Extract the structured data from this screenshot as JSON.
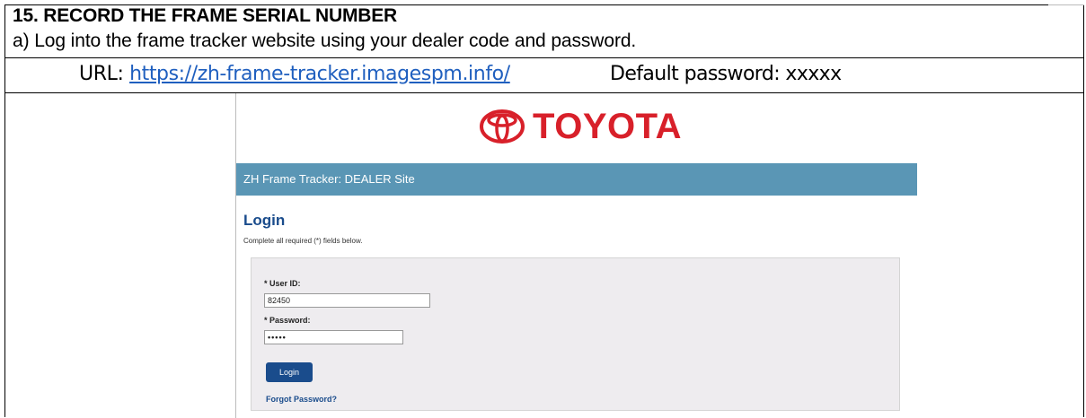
{
  "step": {
    "title": "15. RECORD THE FRAME SERIAL NUMBER",
    "line_a": "a)  Log into the frame tracker website using your dealer code and password."
  },
  "url_row": {
    "label": "URL: ",
    "link": "https://zh-frame-tracker.imagespm.info/",
    "default_password": "Default password: xxxxx"
  },
  "screenshot": {
    "brand": "TOYOTA",
    "brand_color": "#d8202a",
    "site_bar": "ZH Frame Tracker: DEALER Site",
    "site_bar_color": "#5a96b5",
    "login_heading": "Login",
    "required_note": "Complete all required (*) fields below.",
    "user_id_label": "* User ID:",
    "user_id_value": "82450",
    "password_label": "* Password:",
    "password_value": "•••••",
    "login_button": "Login",
    "forgot_link": "Forgot Password?",
    "accent_color": "#1a4c8c"
  }
}
